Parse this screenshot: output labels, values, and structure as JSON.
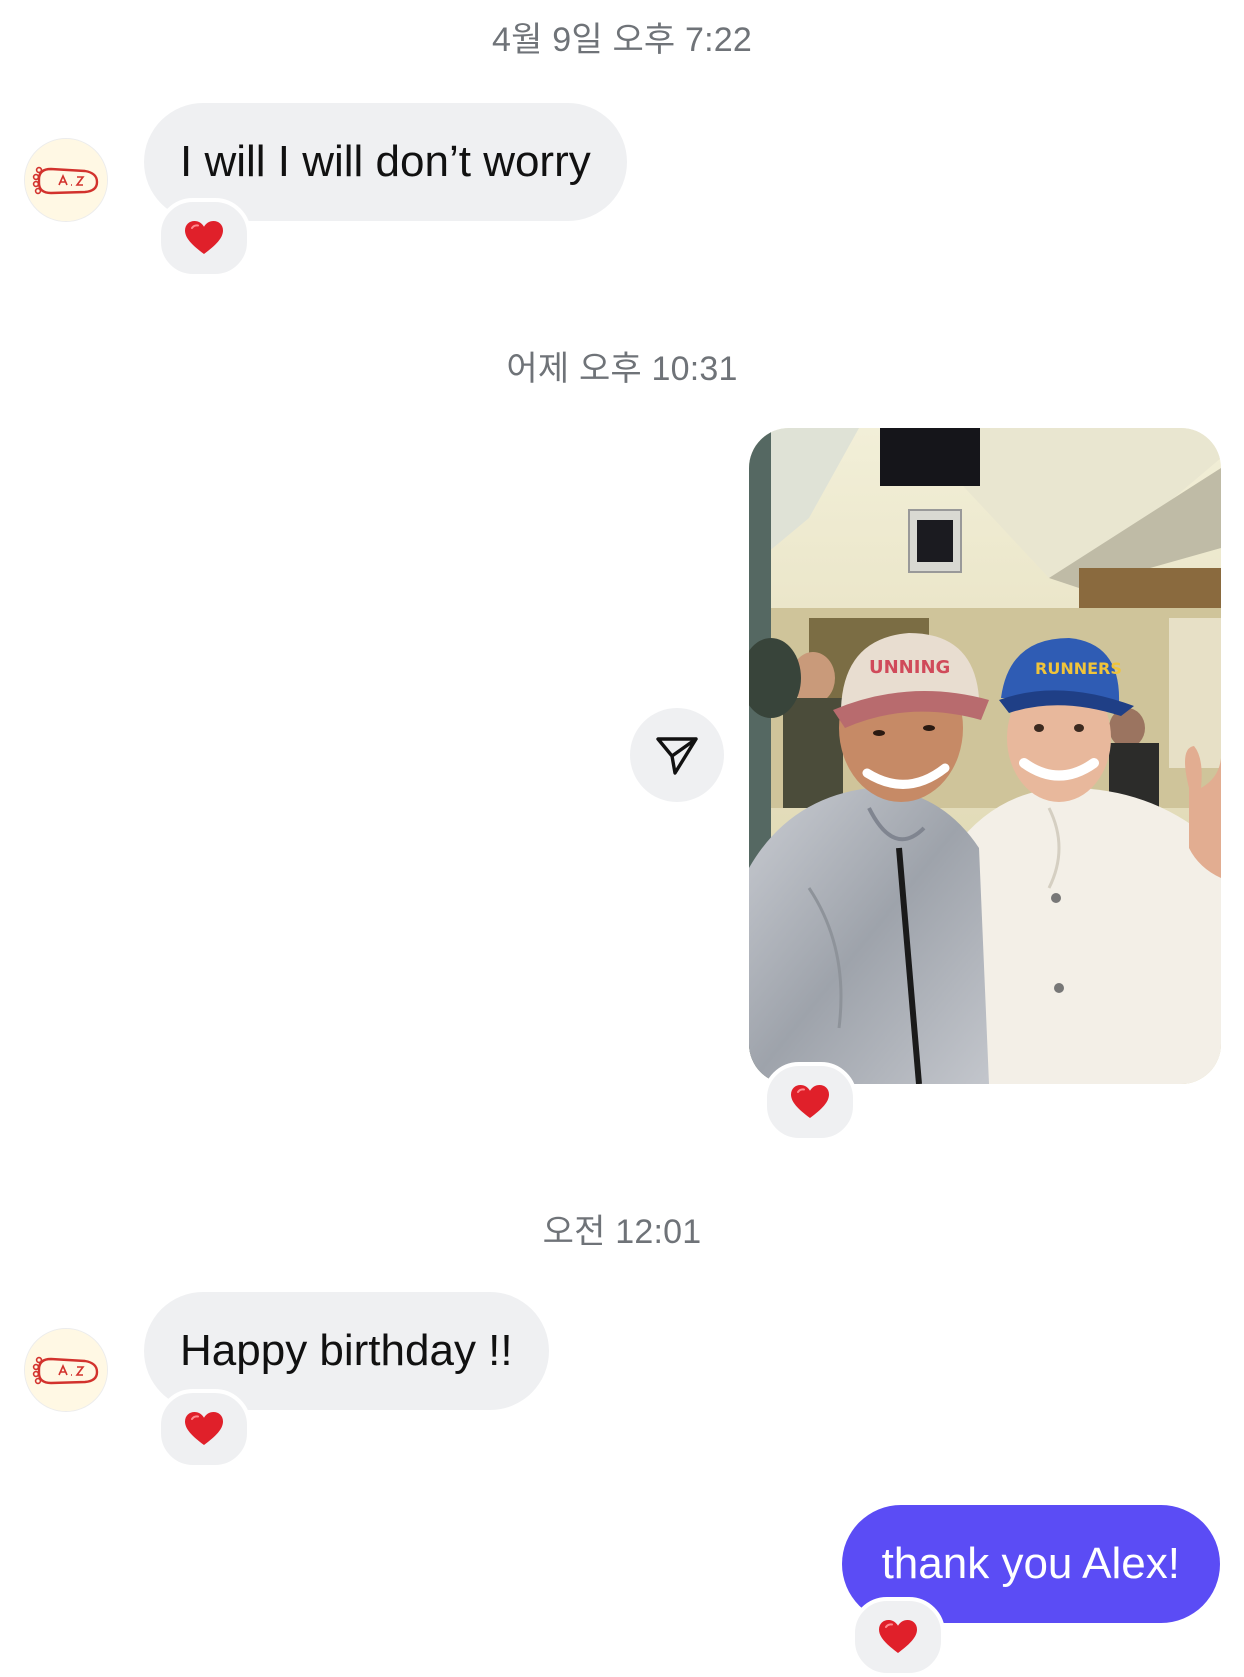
{
  "timestamps": [
    "4월 9일 오후 7:22",
    "어제 오후 10:31",
    "오전 12:01"
  ],
  "messages": [
    {
      "sender": "them",
      "text": "I will I will don’t worry",
      "reaction": "heart"
    },
    {
      "sender": "me",
      "type": "photo",
      "image": "selfie-photo",
      "reaction": "heart"
    },
    {
      "sender": "them",
      "text": "Happy birthday !!",
      "reaction": "heart"
    },
    {
      "sender": "me",
      "text": "thank you Alex!",
      "reaction": "heart"
    }
  ],
  "icons": {
    "avatar": "footprint-avatar-icon",
    "reaction": "heart-icon",
    "share": "paper-plane-icon"
  },
  "colors": {
    "outgoing_bubble": "#5b4cf5",
    "incoming_bubble": "#eff0f2",
    "timestamp_text": "#6f7378",
    "heart": "#e0202a"
  }
}
